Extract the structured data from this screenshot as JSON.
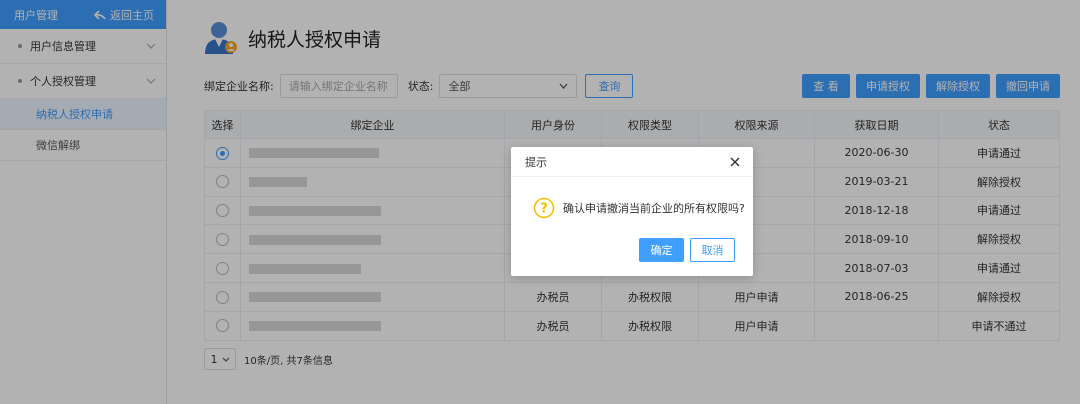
{
  "colors": {
    "accent": "#409eff",
    "overlay": "rgba(0,0,0,0.3)"
  },
  "sidebar": {
    "header_title": "用户管理",
    "back_label": "返回主页",
    "groups": [
      {
        "label": "用户信息管理",
        "expanded": false,
        "items": []
      },
      {
        "label": "个人授权管理",
        "expanded": true,
        "items": [
          {
            "label": "纳税人授权申请",
            "active": true
          },
          {
            "label": "微信解绑",
            "active": false
          }
        ]
      }
    ]
  },
  "page": {
    "title": "纳税人授权申请",
    "title_icon": "user-avatar-icon"
  },
  "filter": {
    "company_label": "绑定企业名称:",
    "company_placeholder": "请输入绑定企业名称",
    "company_value": "",
    "status_label": "状态:",
    "status_value": "全部",
    "query_label": "查询"
  },
  "actions": {
    "view_label": "查 看",
    "apply_label": "申请授权",
    "release_label": "解除授权",
    "withdraw_label": "撤回申请"
  },
  "table": {
    "headers": [
      "选择",
      "绑定企业",
      "用户身份",
      "权限类型",
      "权限来源",
      "获取日期",
      "状态"
    ],
    "rows": [
      {
        "selected": true,
        "company": "",
        "identity": "",
        "perm_type": "",
        "source": "",
        "date": "2020-06-30",
        "status": "申请通过"
      },
      {
        "selected": false,
        "company": "",
        "identity": "",
        "perm_type": "",
        "source": "",
        "date": "2019-03-21",
        "status": "解除授权"
      },
      {
        "selected": false,
        "company": "",
        "identity": "",
        "perm_type": "",
        "source": "",
        "date": "2018-12-18",
        "status": "申请通过"
      },
      {
        "selected": false,
        "company": "",
        "identity": "",
        "perm_type": "",
        "source": "",
        "date": "2018-09-10",
        "status": "解除授权"
      },
      {
        "selected": false,
        "company": "",
        "identity": "",
        "perm_type": "",
        "source": "",
        "date": "2018-07-03",
        "status": "申请通过"
      },
      {
        "selected": false,
        "company": "",
        "identity": "办税员",
        "perm_type": "办税权限",
        "source": "用户申请",
        "date": "2018-06-25",
        "status": "解除授权"
      },
      {
        "selected": false,
        "company": "",
        "identity": "办税员",
        "perm_type": "办税权限",
        "source": "用户申请",
        "date": "",
        "status": "申请不通过"
      }
    ]
  },
  "pager": {
    "page_size_value": "1",
    "info": "10条/页, 共7条信息"
  },
  "dialog": {
    "title": "提示",
    "message": "确认申请撤消当前企业的所有权限吗?",
    "ok_label": "确定",
    "cancel_label": "取消"
  }
}
